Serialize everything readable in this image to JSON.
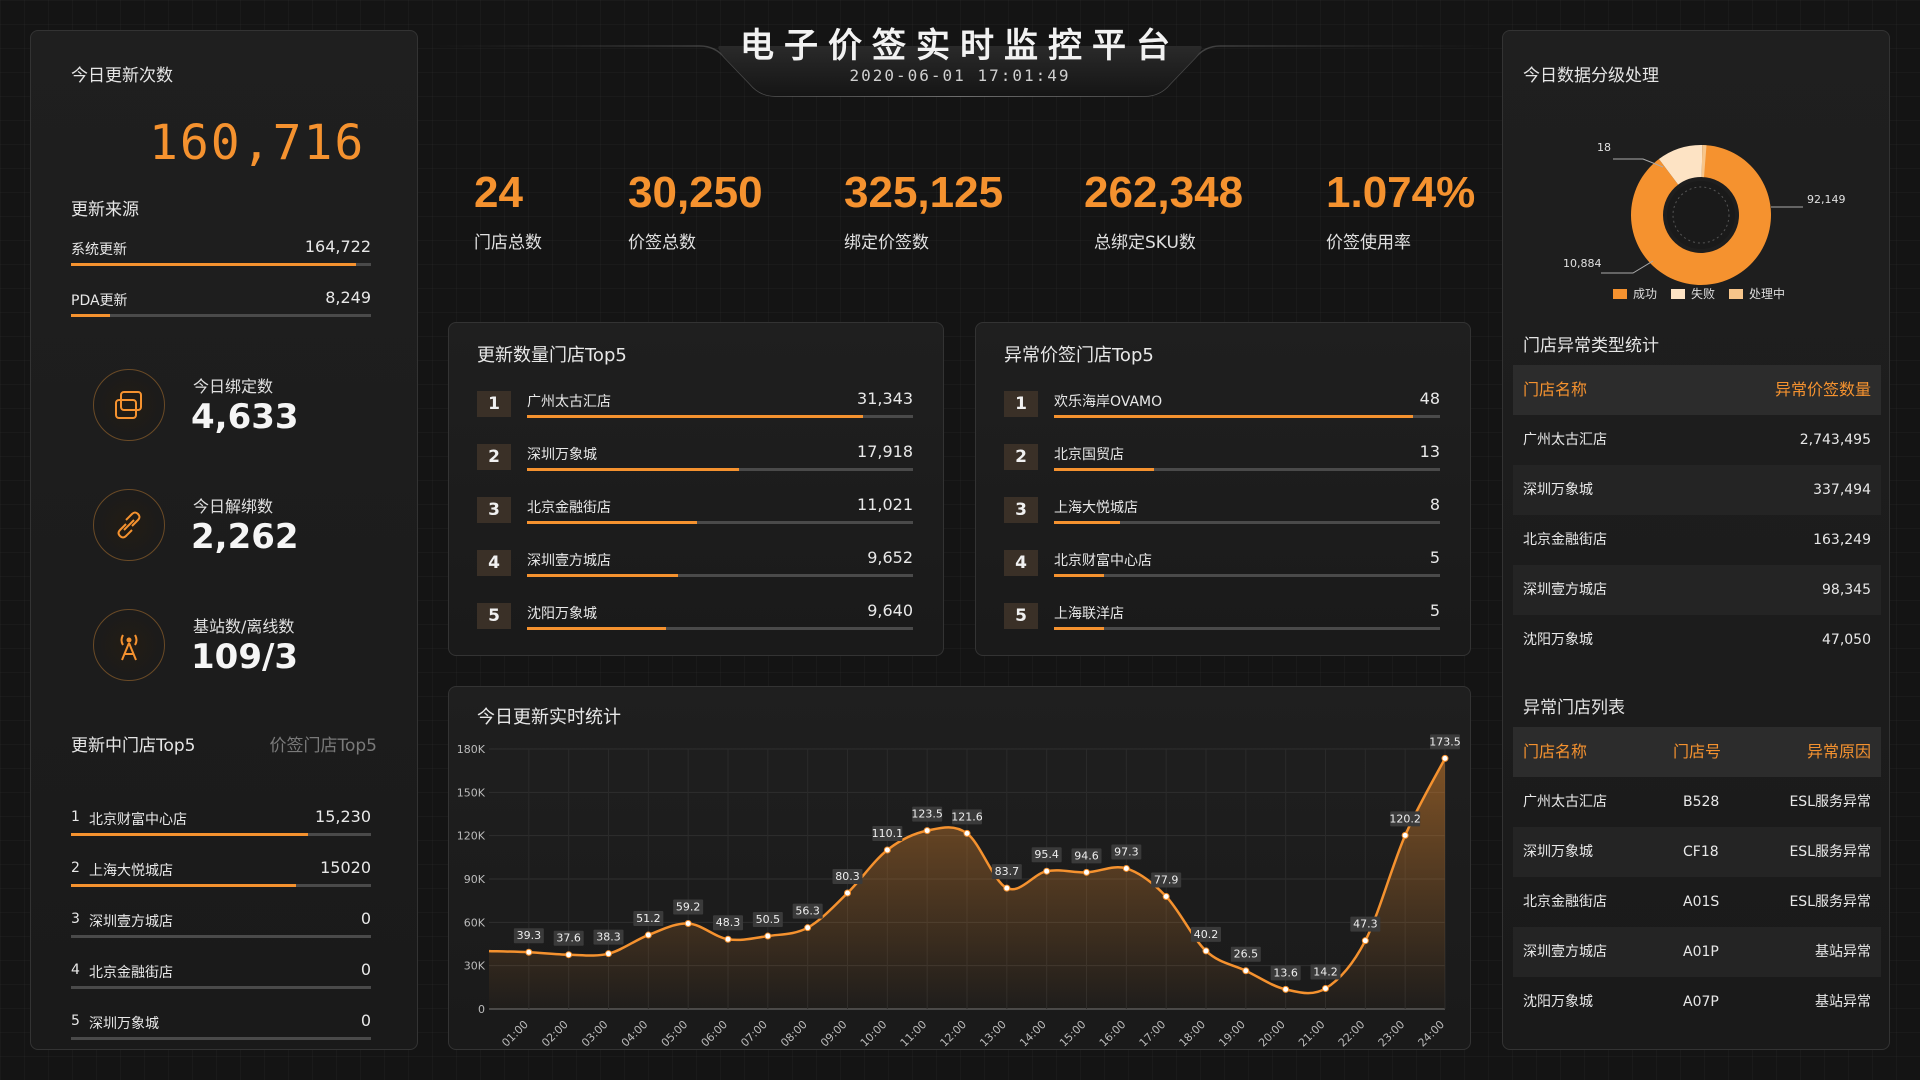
{
  "header": {
    "title": "电子价签实时监控平台",
    "datetime": "2020-06-01 17:01:49"
  },
  "left": {
    "today_updates_label": "今日更新次数",
    "today_updates_value": "160,716",
    "source_title": "更新来源",
    "sources": [
      {
        "label": "系统更新",
        "value": "164,722",
        "ratio": 0.95
      },
      {
        "label": "PDA更新",
        "value": "8,249",
        "ratio": 0.13
      }
    ],
    "stats": [
      {
        "label": "今日绑定数",
        "value": "4,633",
        "icon": "bind-icon"
      },
      {
        "label": "今日解绑数",
        "value": "2,262",
        "icon": "unlink-icon"
      },
      {
        "label": "基站数/离线数",
        "value": "109/3",
        "icon": "antenna-icon"
      }
    ],
    "rank_tab_active": "更新中门店Top5",
    "rank_tab_inactive": "价签门店Top5",
    "ranks": [
      {
        "no": "1",
        "name": "北京财富中心店",
        "value": "15,230",
        "ratio": 0.79
      },
      {
        "no": "2",
        "name": "上海大悦城店",
        "value": "15020",
        "ratio": 0.75
      },
      {
        "no": "3",
        "name": "深圳壹方城店",
        "value": "0",
        "ratio": 0
      },
      {
        "no": "4",
        "name": "北京金融街店",
        "value": "0",
        "ratio": 0
      },
      {
        "no": "5",
        "name": "深圳万象城",
        "value": "0",
        "ratio": 0
      }
    ]
  },
  "kpis": [
    {
      "value": "24",
      "label": "门店总数"
    },
    {
      "value": "30,250",
      "label": "价签总数"
    },
    {
      "value": "325,125",
      "label": "绑定价签数"
    },
    {
      "value": "262,348",
      "label": "总绑定SKU数"
    },
    {
      "value": "1.074%",
      "label": "价签使用率"
    }
  ],
  "update_top5": {
    "title": "更新数量门店Top5",
    "rows": [
      {
        "no": "1",
        "name": "广州太古汇店",
        "value": "31,343",
        "ratio": 0.87
      },
      {
        "no": "2",
        "name": "深圳万象城",
        "value": "17,918",
        "ratio": 0.55
      },
      {
        "no": "3",
        "name": "北京金融街店",
        "value": "11,021",
        "ratio": 0.44
      },
      {
        "no": "4",
        "name": "深圳壹方城店",
        "value": "9,652",
        "ratio": 0.39
      },
      {
        "no": "5",
        "name": "沈阳万象城",
        "value": "9,640",
        "ratio": 0.36
      }
    ]
  },
  "abnormal_top5": {
    "title": "异常价签门店Top5",
    "rows": [
      {
        "no": "1",
        "name": "欢乐海岸OVAMO",
        "value": "48",
        "ratio": 0.93
      },
      {
        "no": "2",
        "name": "北京国贸店",
        "value": "13",
        "ratio": 0.26
      },
      {
        "no": "3",
        "name": "上海大悦城店",
        "value": "8",
        "ratio": 0.17
      },
      {
        "no": "4",
        "name": "北京财富中心店",
        "value": "5",
        "ratio": 0.13
      },
      {
        "no": "5",
        "name": "上海联洋店",
        "value": "5",
        "ratio": 0.13
      }
    ]
  },
  "right": {
    "donut_title": "今日数据分级处理",
    "stats_title": "门店异常类型统计",
    "stats_headers": [
      "门店名称",
      "异常价签数量"
    ],
    "stats_rows": [
      [
        "广州太古汇店",
        "2,743,495"
      ],
      [
        "深圳万象城",
        "337,494"
      ],
      [
        "北京金融街店",
        "163,249"
      ],
      [
        "深圳壹方城店",
        "98,345"
      ],
      [
        "沈阳万象城",
        "47,050"
      ]
    ],
    "list_title": "异常门店列表",
    "list_headers": [
      "门店名称",
      "门店号",
      "异常原因"
    ],
    "list_rows": [
      [
        "广州太古汇店",
        "B528",
        "ESL服务异常"
      ],
      [
        "深圳万象城",
        "CF18",
        "ESL服务异常"
      ],
      [
        "北京金融街店",
        "A01S",
        "ESL服务异常"
      ],
      [
        "深圳壹方城店",
        "A01P",
        "基站异常"
      ],
      [
        "沈阳万象城",
        "A07P",
        "基站异常"
      ]
    ]
  },
  "colors": {
    "accent": "#f5922f",
    "fail": "#fde3c4",
    "processing": "#f7c58a"
  },
  "chart_data": [
    {
      "type": "pie",
      "title": "今日数据分级处理",
      "categories": [
        "成功",
        "失败",
        "处理中"
      ],
      "values": [
        92149,
        10884,
        18
      ],
      "labels": [
        "92,149",
        "10,884",
        "18"
      ],
      "legend_position": "bottom"
    },
    {
      "type": "area",
      "title": "今日更新实时统计",
      "x": [
        "01:00",
        "02:00",
        "03:00",
        "04:00",
        "05:00",
        "06:00",
        "07:00",
        "08:00",
        "09:00",
        "10:00",
        "11:00",
        "12:00",
        "13:00",
        "14:00",
        "15:00",
        "16:00",
        "17:00",
        "18:00",
        "19:00",
        "20:00",
        "21:00",
        "22:00",
        "23:00",
        "24:00"
      ],
      "values": [
        39.3,
        37.6,
        38.3,
        51.2,
        59.2,
        48.3,
        50.5,
        56.3,
        80.3,
        110.1,
        123.5,
        121.6,
        83.7,
        95.4,
        94.6,
        97.3,
        77.9,
        40.2,
        26.5,
        13.6,
        14.2,
        47.3,
        120.2,
        173.5
      ],
      "value_unit": "K",
      "y_ticks": [
        "0",
        "30K",
        "60K",
        "90K",
        "120K",
        "150K",
        "180K"
      ],
      "ylim": [
        0,
        180
      ],
      "grid": true
    }
  ]
}
